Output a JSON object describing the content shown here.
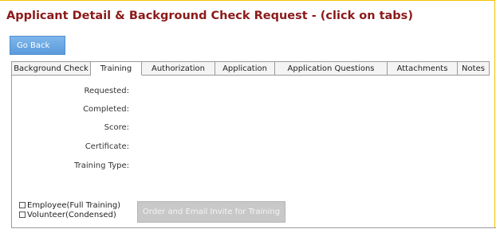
{
  "page": {
    "title": "Applicant Detail & Background Check Request - (click on tabs)"
  },
  "actions": {
    "go_back_label": "Go Back"
  },
  "tabs": [
    {
      "label": "Background Check",
      "active": false
    },
    {
      "label": "Training",
      "active": true
    },
    {
      "label": "Authorization",
      "active": false
    },
    {
      "label": "Application",
      "active": false
    },
    {
      "label": "Application Questions",
      "active": false
    },
    {
      "label": "Attachments",
      "active": false
    },
    {
      "label": "Notes",
      "active": false
    }
  ],
  "training": {
    "fields": [
      {
        "label": "Requested:"
      },
      {
        "label": "Completed:"
      },
      {
        "label": "Score:"
      },
      {
        "label": "Certificate:"
      },
      {
        "label": "Training Type:"
      }
    ],
    "options": [
      {
        "label": "Employee(Full Training)",
        "checked": false
      },
      {
        "label": "Volunteer(Condensed)",
        "checked": false
      }
    ],
    "order_button_label": "Order and Email Invite for Training"
  },
  "colors": {
    "title": "#8b1a1a",
    "accent_border": "#f2c200",
    "primary_button": "#5a9bdc",
    "disabled_button": "#c8c8c8"
  }
}
